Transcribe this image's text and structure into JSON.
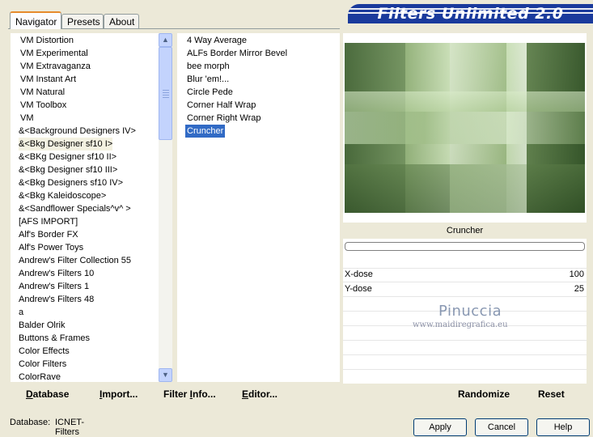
{
  "tabs": [
    {
      "label": "Navigator",
      "active": true
    },
    {
      "label": "Presets",
      "active": false
    },
    {
      "label": "About",
      "active": false
    }
  ],
  "header": {
    "title": "Filters Unlimited 2.0"
  },
  "categories": [
    "VM Distortion",
    "VM Experimental",
    "VM Extravaganza",
    "VM Instant Art",
    "VM Natural",
    "VM Toolbox",
    "VM",
    "&<Background Designers IV>",
    "&<Bkg Designer sf10 I>",
    "&<BKg Designer sf10 II>",
    "&<Bkg Designer sf10 III>",
    "&<Bkg Designers sf10 IV>",
    "&<Bkg Kaleidoscope>",
    "&<Sandflower Specials^v^ >",
    "[AFS IMPORT]",
    "Alf's Border FX",
    "Alf's Power Toys",
    "Andrew's Filter Collection 55",
    "Andrew's Filters 10",
    "Andrew's Filters 1",
    "Andrew's Filters 48",
    "a",
    "Balder Olrik",
    "Buttons & Frames",
    "Color Effects",
    "Color Filters",
    "ColorRave"
  ],
  "selected_category_index": 8,
  "filters": [
    "4 Way Average",
    "ALFs Border Mirror Bevel",
    "bee morph",
    "Blur 'em!...",
    "Circle Pede",
    "Corner Half Wrap",
    "Corner Right Wrap",
    "Cruncher"
  ],
  "selected_filter_index": 7,
  "preview": {
    "filter_name": "Cruncher"
  },
  "params": [
    {
      "label": "X-dose",
      "value": "100"
    },
    {
      "label": "Y-dose",
      "value": "25"
    }
  ],
  "watermark": {
    "name": "Pinuccia",
    "site": "www.maidiregrafica.eu"
  },
  "bottom_left_buttons": [
    {
      "label": "Database",
      "underline": "D",
      "rest": "atabase"
    },
    {
      "label": "Import...",
      "underline": "I",
      "rest": "mport..."
    },
    {
      "label": "Filter Info...",
      "pre": "Filter ",
      "underline": "I",
      "rest": "nfo..."
    },
    {
      "label": "Editor...",
      "underline": "E",
      "rest": "ditor..."
    }
  ],
  "bottom_right_buttons": {
    "randomize": "Randomize",
    "reset": "Reset"
  },
  "status": {
    "label": "Database:",
    "value": "ICNET-Filters"
  },
  "dialog_buttons": {
    "apply": "Apply",
    "cancel": "Cancel",
    "help": "Help"
  },
  "colors": {
    "title_bg": "#1a3a9c",
    "selection": "#316ac5",
    "tab_highlight": "#e68b2c"
  },
  "icons": {
    "scroll_up": "scroll-up-arrow-icon",
    "scroll_down": "scroll-down-arrow-icon"
  }
}
